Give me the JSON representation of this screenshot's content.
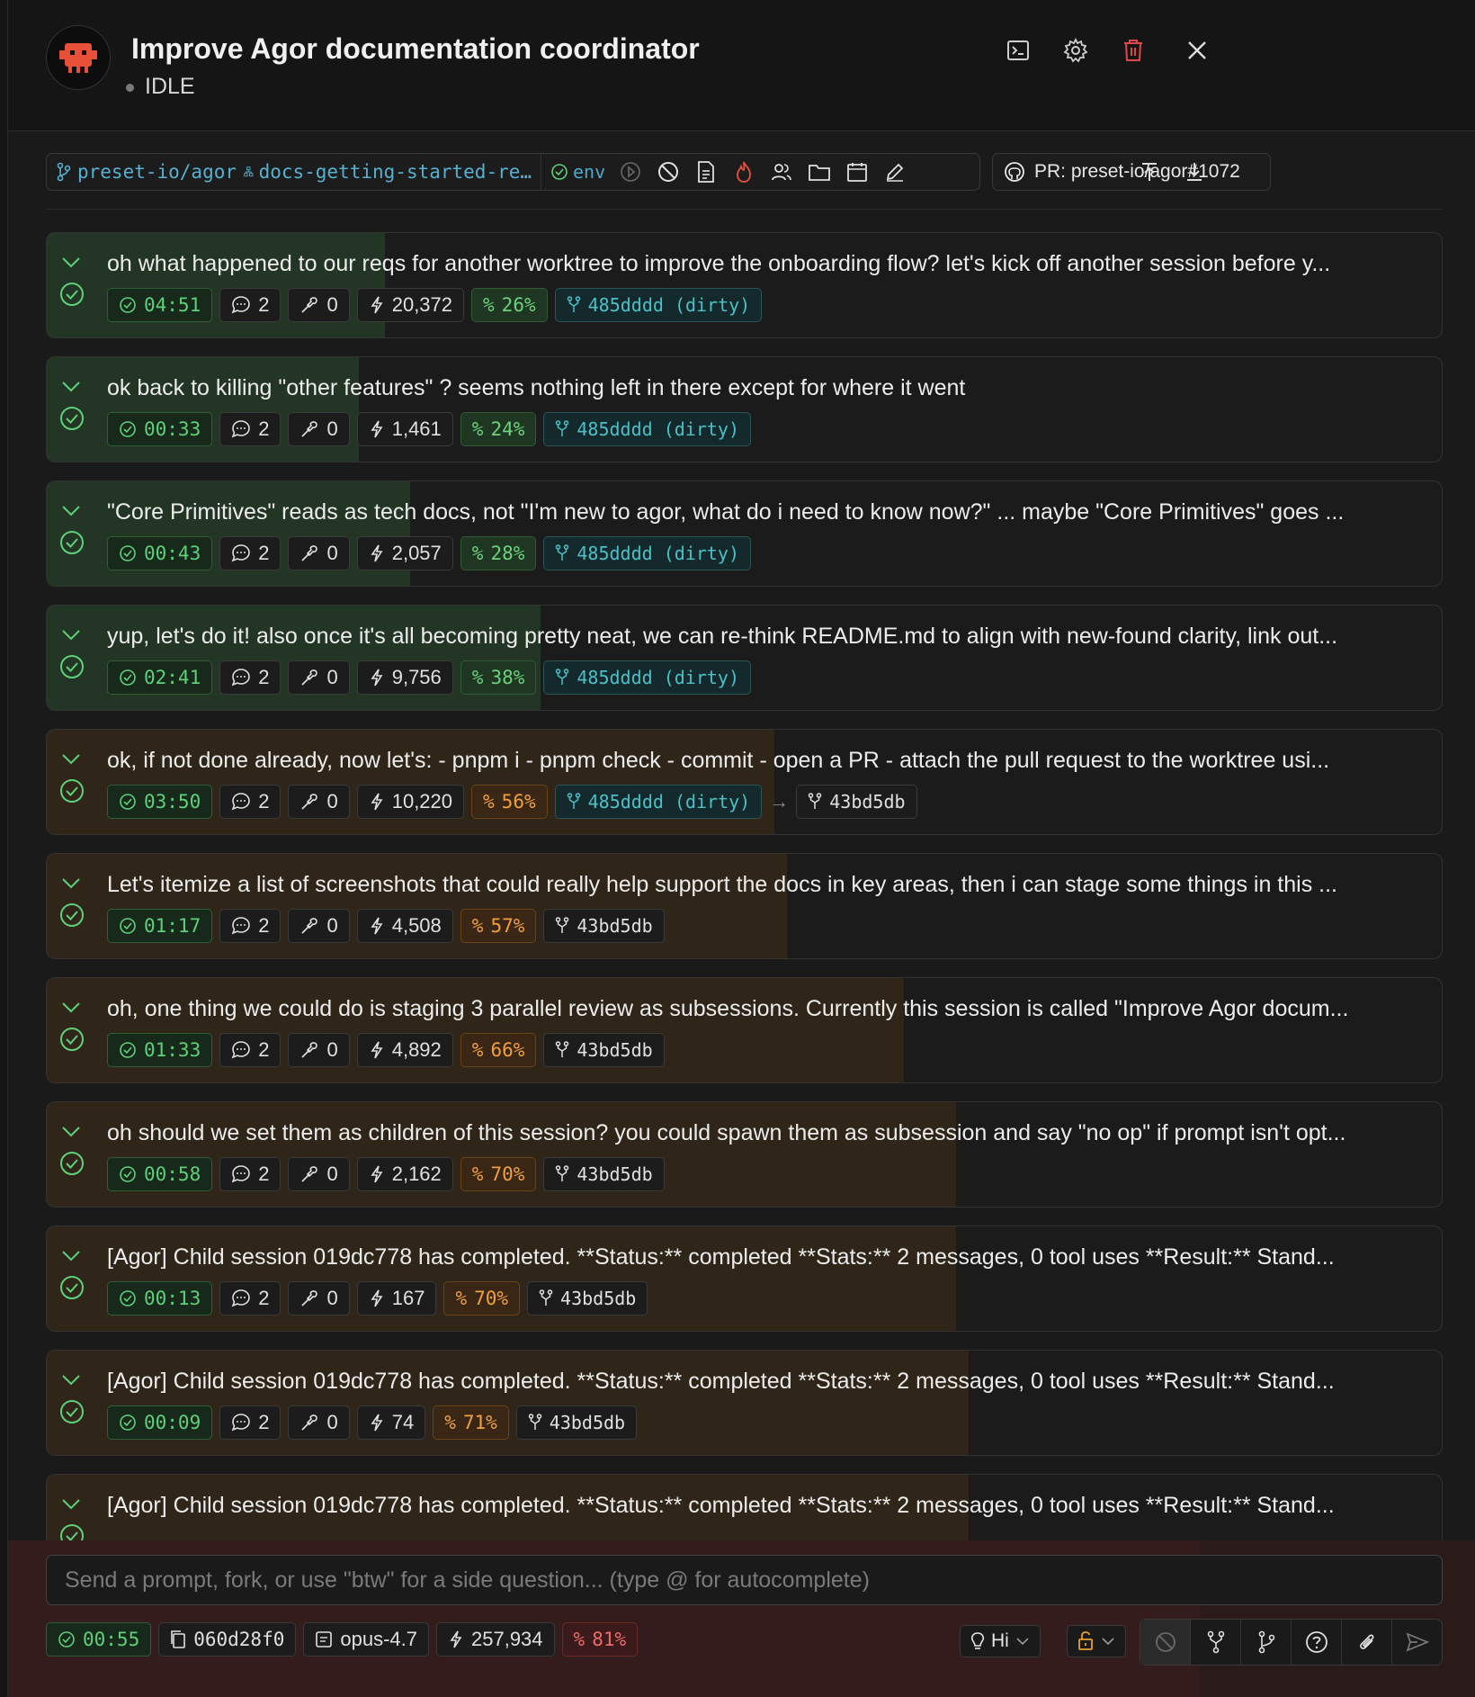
{
  "header": {
    "title": "Improve Agor documentation coordinator",
    "status": "IDLE"
  },
  "toolbar": {
    "repo": "preset-io/agor",
    "branch": "docs-getting-started-re…",
    "env_label": "env",
    "pr_label": "PR: preset-io/agor#1072"
  },
  "messages": [
    {
      "text": "oh what happened to our reqs for another worktree to improve the onboarding flow? let's kick off another session before y...",
      "time": "04:51",
      "msgs": "2",
      "tools": "0",
      "tokens": "20,372",
      "pct": "26%",
      "pct_level": "green",
      "commit_from": "485dddd (dirty)",
      "commit_to": ""
    },
    {
      "text": "ok back to killing \"other features\" ? seems nothing left in there except for where it went",
      "time": "00:33",
      "msgs": "2",
      "tools": "0",
      "tokens": "1,461",
      "pct": "24%",
      "pct_level": "green",
      "commit_from": "485dddd (dirty)",
      "commit_to": ""
    },
    {
      "text": "\"Core Primitives\" reads as tech docs, not \"I'm new to agor, what do i need to know now?\" ... maybe \"Core Primitives\" goes ...",
      "time": "00:43",
      "msgs": "2",
      "tools": "0",
      "tokens": "2,057",
      "pct": "28%",
      "pct_level": "green",
      "commit_from": "485dddd (dirty)",
      "commit_to": ""
    },
    {
      "text": "yup, let's do it! also once it's all becoming pretty neat, we can re-think README.md to align with new-found clarity, link out...",
      "time": "02:41",
      "msgs": "2",
      "tools": "0",
      "tokens": "9,756",
      "pct": "38%",
      "pct_level": "green",
      "commit_from": "485dddd (dirty)",
      "commit_to": ""
    },
    {
      "text": "ok, if not done already, now let's: - pnpm i - pnpm check - commit - open a PR - attach the pull request to the worktree usi...",
      "time": "03:50",
      "msgs": "2",
      "tools": "0",
      "tokens": "10,220",
      "pct": "56%",
      "pct_level": "orange",
      "commit_from": "485dddd (dirty)",
      "commit_to": "43bd5db"
    },
    {
      "text": "Let's itemize a list of screenshots that could really help support the docs in key areas, then i can stage some things in this ...",
      "time": "01:17",
      "msgs": "2",
      "tools": "0",
      "tokens": "4,508",
      "pct": "57%",
      "pct_level": "orange",
      "commit_from": "43bd5db",
      "commit_to": ""
    },
    {
      "text": "oh, one thing we could do is staging 3 parallel review as subsessions. Currently this session is called \"Improve Agor docum...",
      "time": "01:33",
      "msgs": "2",
      "tools": "0",
      "tokens": "4,892",
      "pct": "66%",
      "pct_level": "orange",
      "commit_from": "43bd5db",
      "commit_to": ""
    },
    {
      "text": "oh should we set them as children of this session? you could spawn them as subsession and say \"no op\" if prompt isn't opt...",
      "time": "00:58",
      "msgs": "2",
      "tools": "0",
      "tokens": "2,162",
      "pct": "70%",
      "pct_level": "orange",
      "commit_from": "43bd5db",
      "commit_to": ""
    },
    {
      "text": "[Agor] Child session 019dc778 has completed. **Status:** completed **Stats:** 2 messages, 0 tool uses **Result:** Stand...",
      "time": "00:13",
      "msgs": "2",
      "tools": "0",
      "tokens": "167",
      "pct": "70%",
      "pct_level": "orange",
      "commit_from": "43bd5db",
      "commit_to": ""
    },
    {
      "text": "[Agor] Child session 019dc778 has completed. **Status:** completed **Stats:** 2 messages, 0 tool uses **Result:** Stand...",
      "time": "00:09",
      "msgs": "2",
      "tools": "0",
      "tokens": "74",
      "pct": "71%",
      "pct_level": "orange",
      "commit_from": "43bd5db",
      "commit_to": ""
    },
    {
      "text": "[Agor] Child session 019dc778 has completed. **Status:** completed **Stats:** 2 messages, 0 tool uses **Result:** Stand...",
      "time": "",
      "msgs": "",
      "tools": "",
      "tokens": "",
      "pct": "",
      "pct_level": "orange",
      "commit_from": "",
      "commit_to": ""
    }
  ],
  "composer": {
    "placeholder": "Send a prompt, fork, or use \"btw\" for a side question... (type @ for autocomplete)",
    "time": "00:55",
    "session_id": "060d28f0",
    "model": "opus-4.7",
    "tokens": "257,934",
    "pct": "81%",
    "thinking_label": "Hi"
  },
  "colors": {
    "green_fill": "#233524",
    "orange_fill": "#2f2619",
    "accent_green": "#5fd07a",
    "accent_orange": "#f0a040",
    "accent_red": "#f06a6a",
    "delete_red": "#e04848"
  }
}
